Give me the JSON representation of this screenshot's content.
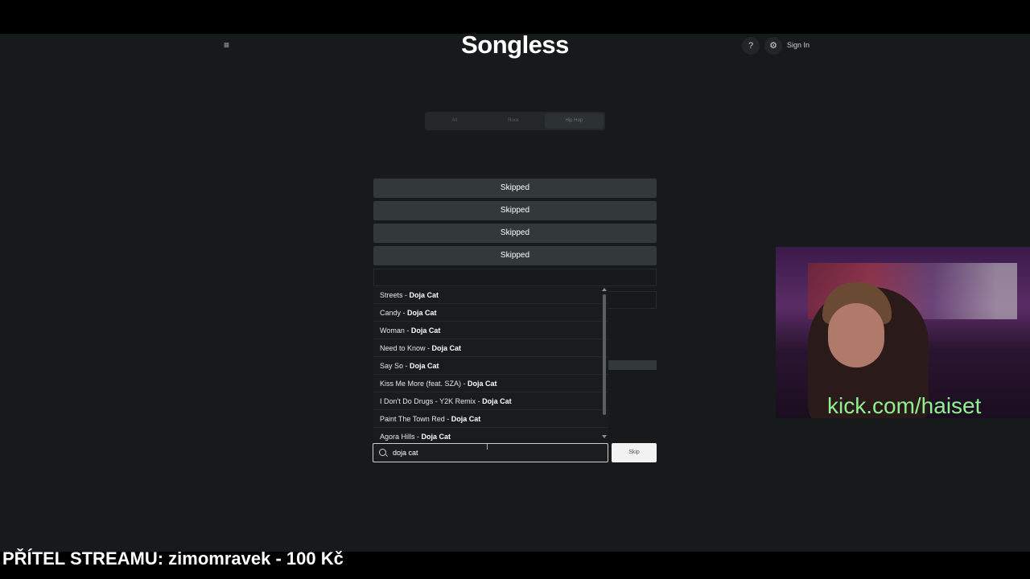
{
  "header": {
    "logo": "Songless",
    "help_label": "?",
    "settings_icon": "gear-icon",
    "sign_in": "Sign In"
  },
  "genre_tabs": [
    {
      "label": "All",
      "active": false
    },
    {
      "label": "Rock",
      "active": false
    },
    {
      "label": "Hip Hop",
      "active": true
    }
  ],
  "guesses": [
    "Skipped",
    "Skipped",
    "Skipped",
    "Skipped"
  ],
  "suggestions": [
    {
      "title": "Streets - ",
      "artist": "Doja Cat"
    },
    {
      "title": "Candy - ",
      "artist": "Doja Cat"
    },
    {
      "title": "Woman - ",
      "artist": "Doja Cat"
    },
    {
      "title": "Need to Know - ",
      "artist": "Doja Cat"
    },
    {
      "title": "Say So - ",
      "artist": "Doja Cat"
    },
    {
      "title": "Kiss Me More (feat. SZA) - ",
      "artist": "Doja Cat"
    },
    {
      "title": "I Don't Do Drugs - Y2K Remix - ",
      "artist": "Doja Cat"
    },
    {
      "title": "Paint The Town Red - ",
      "artist": "Doja Cat"
    },
    {
      "title": "Agora Hills - ",
      "artist": "Doja Cat"
    }
  ],
  "search": {
    "value": "doja cat"
  },
  "skip_button": "Skip",
  "overlay": {
    "webcam_text": "kick.com/haiset",
    "donation_text": "PŘÍTEL STREAMU: zimomravek - 100 Kč"
  }
}
